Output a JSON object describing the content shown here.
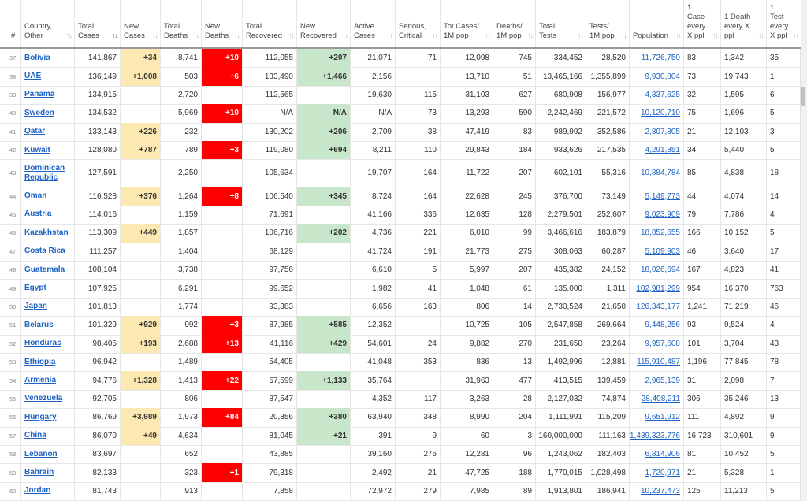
{
  "headers": {
    "rank": "#",
    "country": "Country, Other",
    "total_cases": "Total Cases",
    "new_cases": "New Cases",
    "total_deaths": "Total Deaths",
    "new_deaths": "New Deaths",
    "total_recovered": "Total Recovered",
    "new_recovered": "New Recovered",
    "active": "Active Cases",
    "serious": "Serious, Critical",
    "cases_1m": "Tot Cases/ 1M pop",
    "deaths_1m": "Deaths/ 1M pop",
    "tests": "Total Tests",
    "tests_1m": "Tests/ 1M pop",
    "population": "Population",
    "case_every": "1 Case every X ppl",
    "death_every": "1 Death every X ppl",
    "test_every": "1 Test every X ppl"
  },
  "rows": [
    {
      "rank": "37",
      "country": "Bolivia",
      "total_cases": "141,867",
      "new_cases": "+34",
      "total_deaths": "8,741",
      "new_deaths": "+10",
      "total_recovered": "112,055",
      "new_recovered": "+207",
      "active": "21,071",
      "serious": "71",
      "cases_1m": "12,098",
      "deaths_1m": "745",
      "tests": "334,452",
      "tests_1m": "28,520",
      "population": "11,726,750",
      "case_every": "83",
      "death_every": "1,342",
      "test_every": "35"
    },
    {
      "rank": "38",
      "country": "UAE",
      "total_cases": "136,149",
      "new_cases": "+1,008",
      "total_deaths": "503",
      "new_deaths": "+6",
      "total_recovered": "133,490",
      "new_recovered": "+1,466",
      "active": "2,156",
      "serious": "",
      "cases_1m": "13,710",
      "deaths_1m": "51",
      "tests": "13,465,166",
      "tests_1m": "1,355,899",
      "population": "9,930,804",
      "case_every": "73",
      "death_every": "19,743",
      "test_every": "1"
    },
    {
      "rank": "39",
      "country": "Panama",
      "total_cases": "134,915",
      "new_cases": "",
      "total_deaths": "2,720",
      "new_deaths": "",
      "total_recovered": "112,565",
      "new_recovered": "",
      "active": "19,630",
      "serious": "115",
      "cases_1m": "31,103",
      "deaths_1m": "627",
      "tests": "680,908",
      "tests_1m": "156,977",
      "population": "4,337,625",
      "case_every": "32",
      "death_every": "1,595",
      "test_every": "6"
    },
    {
      "rank": "40",
      "country": "Sweden",
      "total_cases": "134,532",
      "new_cases": "",
      "total_deaths": "5,969",
      "new_deaths": "+10",
      "total_recovered": "N/A",
      "new_recovered": "N/A",
      "active": "N/A",
      "serious": "73",
      "cases_1m": "13,293",
      "deaths_1m": "590",
      "tests": "2,242,469",
      "tests_1m": "221,572",
      "population": "10,120,710",
      "case_every": "75",
      "death_every": "1,696",
      "test_every": "5"
    },
    {
      "rank": "41",
      "country": "Qatar",
      "total_cases": "133,143",
      "new_cases": "+226",
      "total_deaths": "232",
      "new_deaths": "",
      "total_recovered": "130,202",
      "new_recovered": "+206",
      "active": "2,709",
      "serious": "38",
      "cases_1m": "47,419",
      "deaths_1m": "83",
      "tests": "989,992",
      "tests_1m": "352,586",
      "population": "2,807,805",
      "case_every": "21",
      "death_every": "12,103",
      "test_every": "3"
    },
    {
      "rank": "42",
      "country": "Kuwait",
      "total_cases": "128,080",
      "new_cases": "+787",
      "total_deaths": "789",
      "new_deaths": "+3",
      "total_recovered": "119,080",
      "new_recovered": "+694",
      "active": "8,211",
      "serious": "110",
      "cases_1m": "29,843",
      "deaths_1m": "184",
      "tests": "933,626",
      "tests_1m": "217,535",
      "population": "4,291,851",
      "case_every": "34",
      "death_every": "5,440",
      "test_every": "5"
    },
    {
      "rank": "43",
      "country": "Dominican Republic",
      "total_cases": "127,591",
      "new_cases": "",
      "total_deaths": "2,250",
      "new_deaths": "",
      "total_recovered": "105,634",
      "new_recovered": "",
      "active": "19,707",
      "serious": "164",
      "cases_1m": "11,722",
      "deaths_1m": "207",
      "tests": "602,101",
      "tests_1m": "55,316",
      "population": "10,884,784",
      "case_every": "85",
      "death_every": "4,838",
      "test_every": "18"
    },
    {
      "rank": "44",
      "country": "Oman",
      "total_cases": "116,528",
      "new_cases": "+376",
      "total_deaths": "1,264",
      "new_deaths": "+8",
      "total_recovered": "106,540",
      "new_recovered": "+345",
      "active": "8,724",
      "serious": "164",
      "cases_1m": "22,628",
      "deaths_1m": "245",
      "tests": "376,700",
      "tests_1m": "73,149",
      "population": "5,149,773",
      "case_every": "44",
      "death_every": "4,074",
      "test_every": "14"
    },
    {
      "rank": "45",
      "country": "Austria",
      "total_cases": "114,016",
      "new_cases": "",
      "total_deaths": "1,159",
      "new_deaths": "",
      "total_recovered": "71,691",
      "new_recovered": "",
      "active": "41,166",
      "serious": "336",
      "cases_1m": "12,635",
      "deaths_1m": "128",
      "tests": "2,279,501",
      "tests_1m": "252,607",
      "population": "9,023,909",
      "case_every": "79",
      "death_every": "7,786",
      "test_every": "4"
    },
    {
      "rank": "46",
      "country": "Kazakhstan",
      "total_cases": "113,309",
      "new_cases": "+449",
      "total_deaths": "1,857",
      "new_deaths": "",
      "total_recovered": "106,716",
      "new_recovered": "+202",
      "active": "4,736",
      "serious": "221",
      "cases_1m": "6,010",
      "deaths_1m": "99",
      "tests": "3,466,616",
      "tests_1m": "183,879",
      "population": "18,852,655",
      "case_every": "166",
      "death_every": "10,152",
      "test_every": "5"
    },
    {
      "rank": "47",
      "country": "Costa Rica",
      "total_cases": "111,257",
      "new_cases": "",
      "total_deaths": "1,404",
      "new_deaths": "",
      "total_recovered": "68,129",
      "new_recovered": "",
      "active": "41,724",
      "serious": "191",
      "cases_1m": "21,773",
      "deaths_1m": "275",
      "tests": "308,063",
      "tests_1m": "60,287",
      "population": "5,109,903",
      "case_every": "46",
      "death_every": "3,640",
      "test_every": "17"
    },
    {
      "rank": "48",
      "country": "Guatemala",
      "total_cases": "108,104",
      "new_cases": "",
      "total_deaths": "3,738",
      "new_deaths": "",
      "total_recovered": "97,756",
      "new_recovered": "",
      "active": "6,610",
      "serious": "5",
      "cases_1m": "5,997",
      "deaths_1m": "207",
      "tests": "435,382",
      "tests_1m": "24,152",
      "population": "18,026,694",
      "case_every": "167",
      "death_every": "4,823",
      "test_every": "41"
    },
    {
      "rank": "49",
      "country": "Egypt",
      "total_cases": "107,925",
      "new_cases": "",
      "total_deaths": "6,291",
      "new_deaths": "",
      "total_recovered": "99,652",
      "new_recovered": "",
      "active": "1,982",
      "serious": "41",
      "cases_1m": "1,048",
      "deaths_1m": "61",
      "tests": "135,000",
      "tests_1m": "1,311",
      "population": "102,981,299",
      "case_every": "954",
      "death_every": "16,370",
      "test_every": "763"
    },
    {
      "rank": "50",
      "country": "Japan",
      "total_cases": "101,813",
      "new_cases": "",
      "total_deaths": "1,774",
      "new_deaths": "",
      "total_recovered": "93,383",
      "new_recovered": "",
      "active": "6,656",
      "serious": "163",
      "cases_1m": "806",
      "deaths_1m": "14",
      "tests": "2,730,524",
      "tests_1m": "21,650",
      "population": "126,343,177",
      "case_every": "1,241",
      "death_every": "71,219",
      "test_every": "46"
    },
    {
      "rank": "51",
      "country": "Belarus",
      "total_cases": "101,329",
      "new_cases": "+929",
      "total_deaths": "992",
      "new_deaths": "+3",
      "total_recovered": "87,985",
      "new_recovered": "+585",
      "active": "12,352",
      "serious": "",
      "cases_1m": "10,725",
      "deaths_1m": "105",
      "tests": "2,547,858",
      "tests_1m": "269,664",
      "population": "9,448,256",
      "case_every": "93",
      "death_every": "9,524",
      "test_every": "4"
    },
    {
      "rank": "52",
      "country": "Honduras",
      "total_cases": "98,405",
      "new_cases": "+193",
      "total_deaths": "2,688",
      "new_deaths": "+13",
      "total_recovered": "41,116",
      "new_recovered": "+429",
      "active": "54,601",
      "serious": "24",
      "cases_1m": "9,882",
      "deaths_1m": "270",
      "tests": "231,650",
      "tests_1m": "23,264",
      "population": "9,957,608",
      "case_every": "101",
      "death_every": "3,704",
      "test_every": "43"
    },
    {
      "rank": "53",
      "country": "Ethiopia",
      "total_cases": "96,942",
      "new_cases": "",
      "total_deaths": "1,489",
      "new_deaths": "",
      "total_recovered": "54,405",
      "new_recovered": "",
      "active": "41,048",
      "serious": "353",
      "cases_1m": "836",
      "deaths_1m": "13",
      "tests": "1,492,996",
      "tests_1m": "12,881",
      "population": "115,910,487",
      "case_every": "1,196",
      "death_every": "77,845",
      "test_every": "78"
    },
    {
      "rank": "54",
      "country": "Armenia",
      "total_cases": "94,776",
      "new_cases": "+1,328",
      "total_deaths": "1,413",
      "new_deaths": "+22",
      "total_recovered": "57,599",
      "new_recovered": "+1,133",
      "active": "35,764",
      "serious": "",
      "cases_1m": "31,963",
      "deaths_1m": "477",
      "tests": "413,515",
      "tests_1m": "139,459",
      "population": "2,965,139",
      "case_every": "31",
      "death_every": "2,098",
      "test_every": "7"
    },
    {
      "rank": "55",
      "country": "Venezuela",
      "total_cases": "92,705",
      "new_cases": "",
      "total_deaths": "806",
      "new_deaths": "",
      "total_recovered": "87,547",
      "new_recovered": "",
      "active": "4,352",
      "serious": "117",
      "cases_1m": "3,263",
      "deaths_1m": "28",
      "tests": "2,127,032",
      "tests_1m": "74,874",
      "population": "28,408,211",
      "case_every": "306",
      "death_every": "35,246",
      "test_every": "13"
    },
    {
      "rank": "56",
      "country": "Hungary",
      "total_cases": "86,769",
      "new_cases": "+3,989",
      "total_deaths": "1,973",
      "new_deaths": "+84",
      "total_recovered": "20,856",
      "new_recovered": "+380",
      "active": "63,940",
      "serious": "348",
      "cases_1m": "8,990",
      "deaths_1m": "204",
      "tests": "1,111,991",
      "tests_1m": "115,209",
      "population": "9,651,912",
      "case_every": "111",
      "death_every": "4,892",
      "test_every": "9"
    },
    {
      "rank": "57",
      "country": "China",
      "total_cases": "86,070",
      "new_cases": "+49",
      "total_deaths": "4,634",
      "new_deaths": "",
      "total_recovered": "81,045",
      "new_recovered": "+21",
      "active": "391",
      "serious": "9",
      "cases_1m": "60",
      "deaths_1m": "3",
      "tests": "160,000,000",
      "tests_1m": "111,163",
      "population": "1,439,323,776",
      "case_every": "16,723",
      "death_every": "310,601",
      "test_every": "9"
    },
    {
      "rank": "58",
      "country": "Lebanon",
      "total_cases": "83,697",
      "new_cases": "",
      "total_deaths": "652",
      "new_deaths": "",
      "total_recovered": "43,885",
      "new_recovered": "",
      "active": "39,160",
      "serious": "276",
      "cases_1m": "12,281",
      "deaths_1m": "96",
      "tests": "1,243,062",
      "tests_1m": "182,403",
      "population": "6,814,906",
      "case_every": "81",
      "death_every": "10,452",
      "test_every": "5"
    },
    {
      "rank": "59",
      "country": "Bahrain",
      "total_cases": "82,133",
      "new_cases": "",
      "total_deaths": "323",
      "new_deaths": "+1",
      "total_recovered": "79,318",
      "new_recovered": "",
      "active": "2,492",
      "serious": "21",
      "cases_1m": "47,725",
      "deaths_1m": "188",
      "tests": "1,770,015",
      "tests_1m": "1,028,498",
      "population": "1,720,971",
      "case_every": "21",
      "death_every": "5,328",
      "test_every": "1"
    },
    {
      "rank": "60",
      "country": "Jordan",
      "total_cases": "81,743",
      "new_cases": "",
      "total_deaths": "913",
      "new_deaths": "",
      "total_recovered": "7,858",
      "new_recovered": "",
      "active": "72,972",
      "serious": "279",
      "cases_1m": "7,985",
      "deaths_1m": "89",
      "tests": "1,913,801",
      "tests_1m": "186,941",
      "population": "10,237,473",
      "case_every": "125",
      "death_every": "11,213",
      "test_every": "5"
    }
  ]
}
